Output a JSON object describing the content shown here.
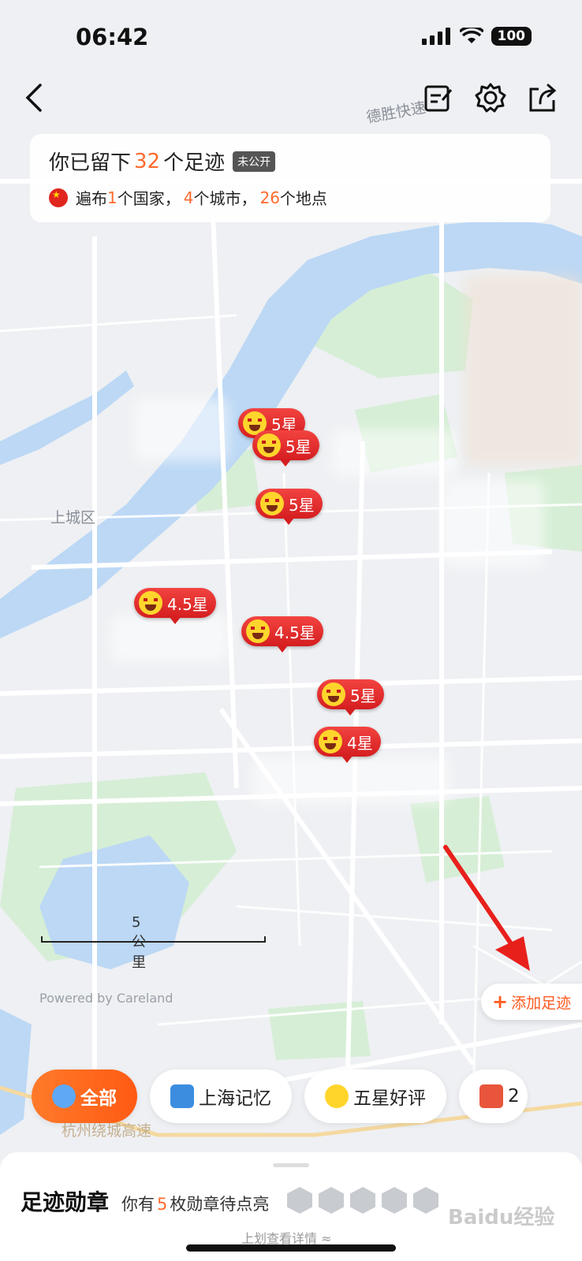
{
  "status_bar": {
    "time": "06:42",
    "battery": "100"
  },
  "summary": {
    "prefix": "你已留下",
    "count": "32",
    "suffix": "个足迹",
    "privacy_badge": "未公开",
    "stats": [
      {
        "text": "遍布",
        "value": "1",
        "unit": "个国家，"
      },
      {
        "value": "4",
        "unit": "个城市，"
      },
      {
        "value": "26",
        "unit": "个地点"
      }
    ]
  },
  "map": {
    "labels": [
      "上城区",
      "德胜快速",
      "杭州绕城高速"
    ],
    "scale_label": "5公里",
    "powered_by": "Powered by Careland",
    "markers": [
      {
        "rating": "5星"
      },
      {
        "rating": "5星"
      },
      {
        "rating": "5星"
      },
      {
        "rating": "4.5星"
      },
      {
        "rating": "4.5星"
      },
      {
        "rating": "5星"
      },
      {
        "rating": "4星"
      }
    ]
  },
  "add_footprint_label": "添加足迹",
  "filters": [
    {
      "label": "全部",
      "icon": "map-pin-icon",
      "active": true
    },
    {
      "label": "上海记忆",
      "icon": "building-icon",
      "active": false
    },
    {
      "label": "五星好评",
      "icon": "star-eyes-icon",
      "active": false
    },
    {
      "label": "2",
      "icon": "calendar-icon",
      "active": false
    }
  ],
  "badges": {
    "title": "足迹勋章",
    "subtitle_prefix": "你有",
    "count": "5",
    "subtitle_suffix": "枚勋章待点亮",
    "swipe_hint": "上划查看详情 ≈"
  },
  "watermark": "Baidu经验",
  "colors": {
    "accent": "#ff6a2c",
    "marker": "#e02a26",
    "water": "#bcd8f5",
    "park": "#d6eed6"
  }
}
